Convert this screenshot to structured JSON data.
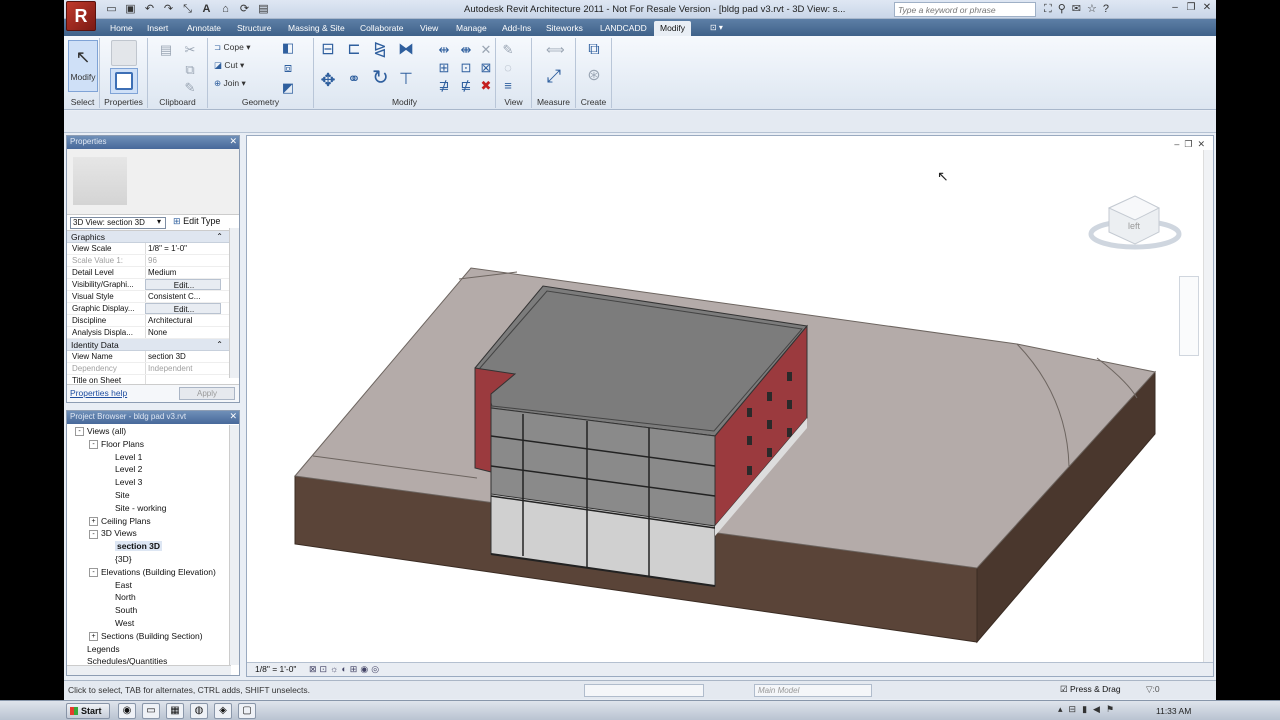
{
  "window": {
    "title": "Autodesk Revit Architecture 2011 - Not For Resale Version - [bldg pad v3.rvt - 3D View: s...",
    "search_placeholder": "Type a keyword or phrase",
    "app_logo": "R"
  },
  "tabs": [
    "Home",
    "Insert",
    "Annotate",
    "Structure",
    "Massing & Site",
    "Collaborate",
    "View",
    "Manage",
    "Add-Ins",
    "Siteworks",
    "LANDCADD",
    "Modify"
  ],
  "active_tab": "Modify",
  "ribbon": {
    "modify_label": "Modify",
    "properties_label": "Properties",
    "cope_label": "Cope",
    "cut_label": "Cut",
    "join_label": "Join",
    "groups": [
      "Select",
      "Properties",
      "Clipboard",
      "Geometry",
      "Modify",
      "View",
      "Measure",
      "Create"
    ]
  },
  "properties": {
    "title": "Properties",
    "type_selector": "3D View: section 3D",
    "edit_type": "Edit Type",
    "sections": {
      "graphics": "Graphics",
      "identity": "Identity Data"
    },
    "graphics_rows": [
      {
        "k": "View Scale",
        "v": "1/8\" = 1'-0\""
      },
      {
        "k": "Scale Value    1:",
        "v": "96"
      },
      {
        "k": "Detail Level",
        "v": "Medium"
      },
      {
        "k": "Visibility/Graphi...",
        "v": "Edit..."
      },
      {
        "k": "Visual Style",
        "v": "Consistent C..."
      },
      {
        "k": "Graphic Display...",
        "v": "Edit..."
      },
      {
        "k": "Discipline",
        "v": "Architectural"
      },
      {
        "k": "Analysis Displa...",
        "v": "None"
      }
    ],
    "identity_rows": [
      {
        "k": "View Name",
        "v": "section 3D"
      },
      {
        "k": "Dependency",
        "v": "Independent"
      },
      {
        "k": "Title on Sheet",
        "v": ""
      }
    ],
    "help_link": "Properties help",
    "apply": "Apply"
  },
  "browser": {
    "title": "Project Browser - bldg pad v3.rvt",
    "nodes": [
      {
        "label": "Views (all)",
        "level": 0,
        "toggle": "-"
      },
      {
        "label": "Floor Plans",
        "level": 1,
        "toggle": "-"
      },
      {
        "label": "Level 1",
        "level": 2,
        "toggle": ""
      },
      {
        "label": "Level 2",
        "level": 2,
        "toggle": ""
      },
      {
        "label": "Level 3",
        "level": 2,
        "toggle": ""
      },
      {
        "label": "Site",
        "level": 2,
        "toggle": ""
      },
      {
        "label": "Site - working",
        "level": 2,
        "toggle": ""
      },
      {
        "label": "Ceiling Plans",
        "level": 1,
        "toggle": "+"
      },
      {
        "label": "3D Views",
        "level": 1,
        "toggle": "-"
      },
      {
        "label": "section 3D",
        "level": 2,
        "toggle": "",
        "selected": true
      },
      {
        "label": "{3D}",
        "level": 2,
        "toggle": ""
      },
      {
        "label": "Elevations (Building Elevation)",
        "level": 1,
        "toggle": "-"
      },
      {
        "label": "East",
        "level": 2,
        "toggle": ""
      },
      {
        "label": "North",
        "level": 2,
        "toggle": ""
      },
      {
        "label": "South",
        "level": 2,
        "toggle": ""
      },
      {
        "label": "West",
        "level": 2,
        "toggle": ""
      },
      {
        "label": "Sections (Building Section)",
        "level": 1,
        "toggle": "+"
      },
      {
        "label": "Legends",
        "level": 0,
        "toggle": ""
      },
      {
        "label": "Schedules/Quantities",
        "level": 0,
        "toggle": ""
      }
    ]
  },
  "view": {
    "scale": "1/8\" = 1'-0\"",
    "viewcube_label": "left"
  },
  "status": {
    "text": "Click to select, TAB for alternates, CTRL adds, SHIFT unselects.",
    "main_model": "Main Model",
    "press_drag": "Press & Drag",
    "filter": ":0"
  },
  "taskbar": {
    "start": "Start",
    "clock": "11:33 AM"
  },
  "colors": {
    "ribbon_tab_bg": "#3f6189",
    "brick": "#9b3a3e",
    "earth": "#5c463a",
    "site": "#b3aaa8",
    "roof": "#7d7d7d"
  }
}
